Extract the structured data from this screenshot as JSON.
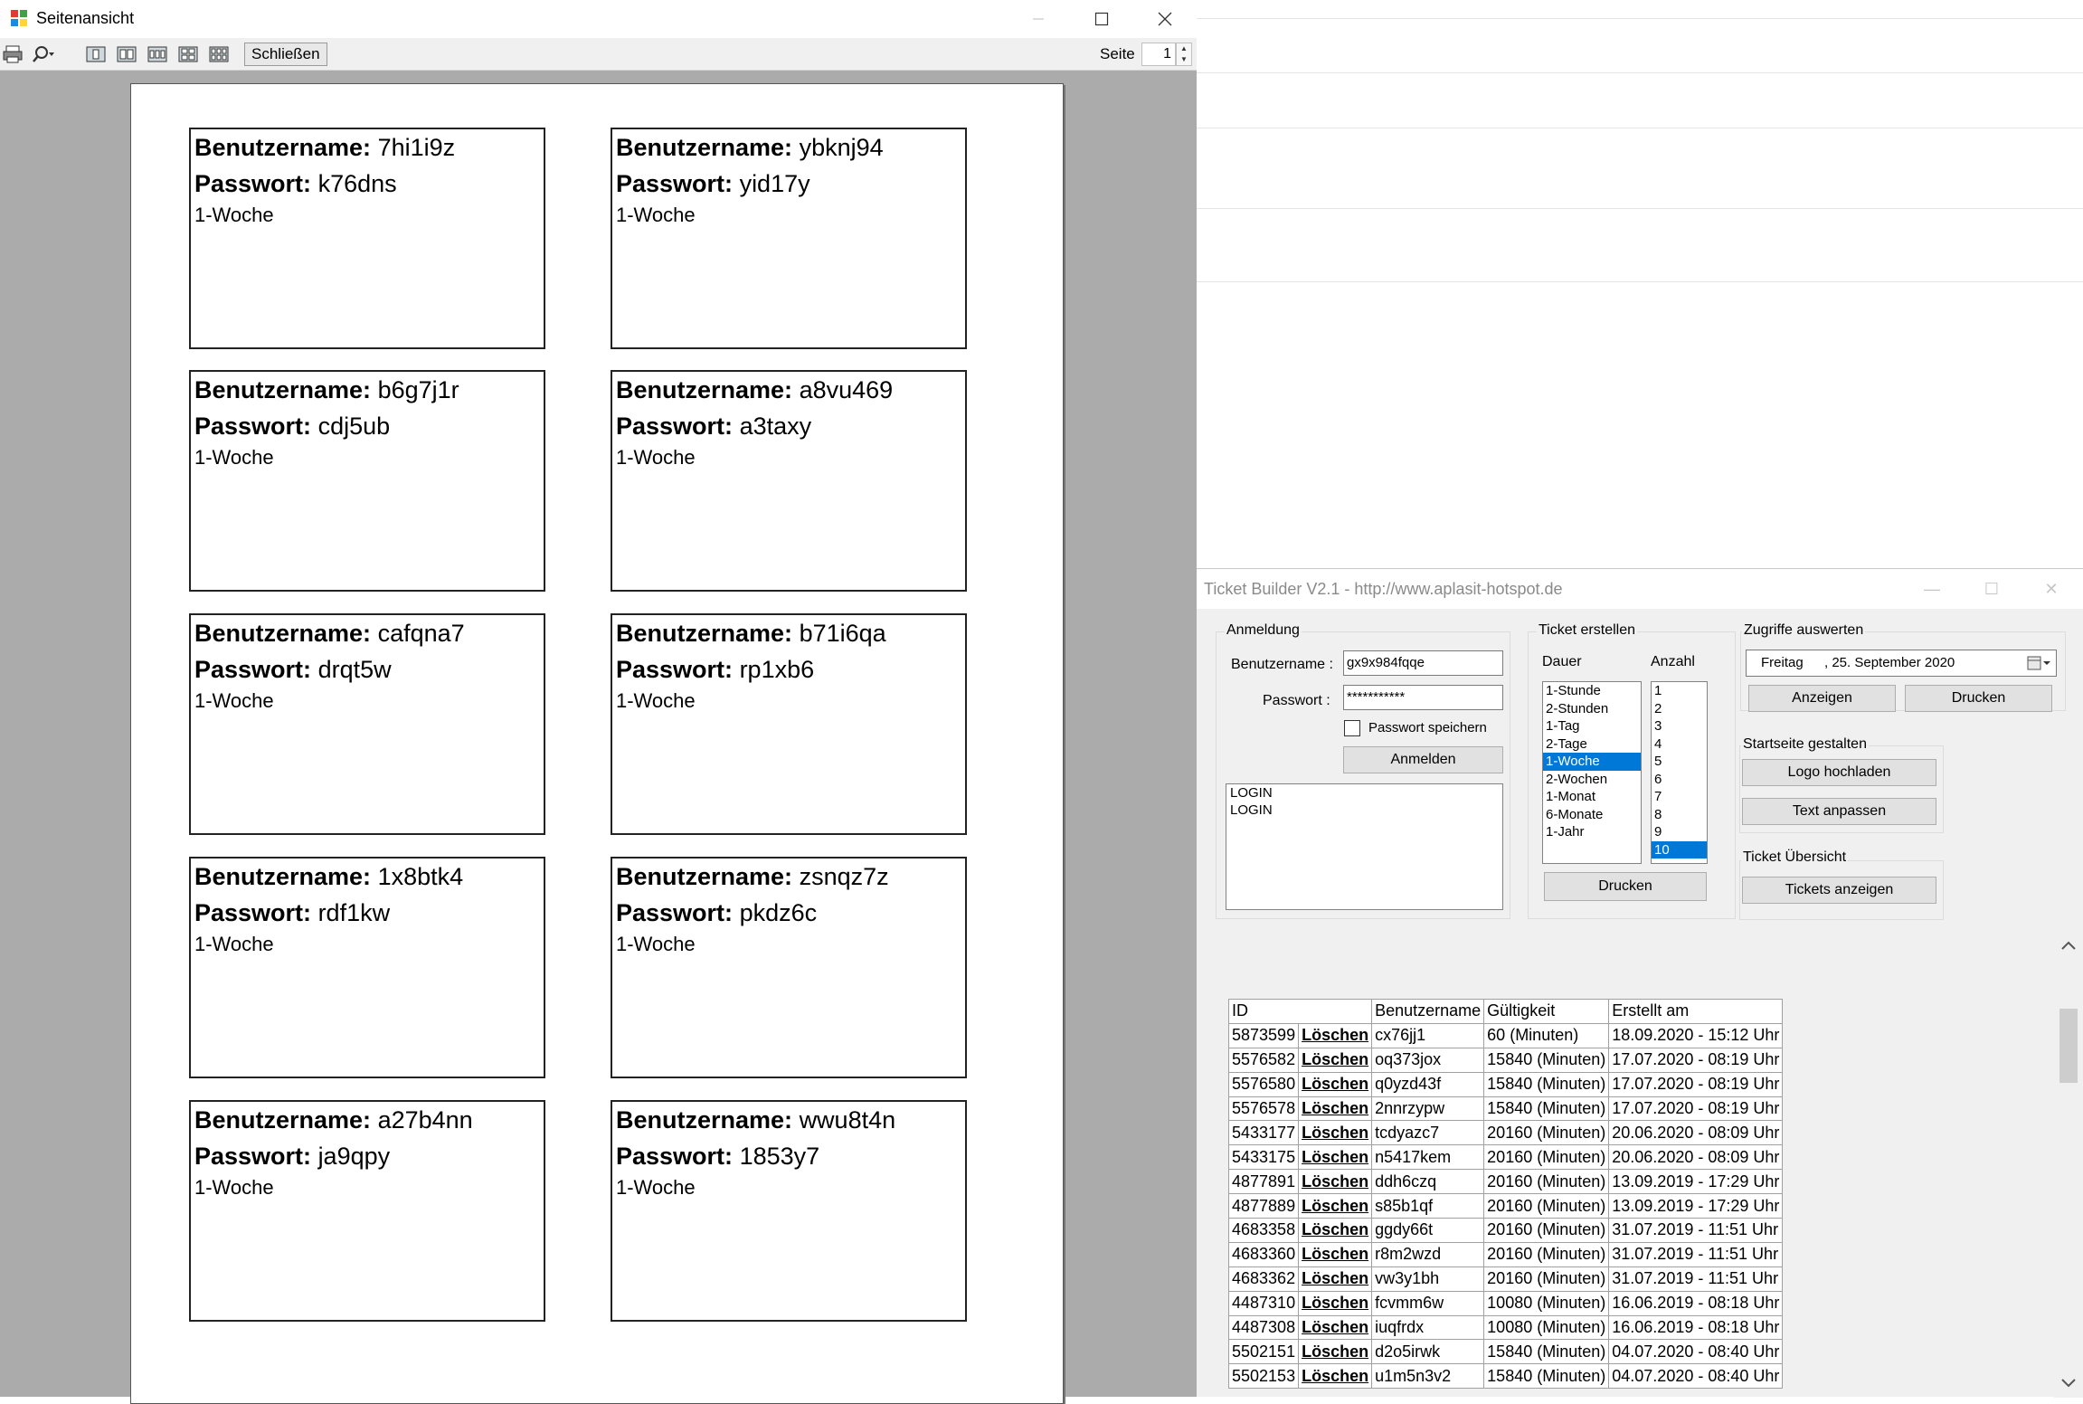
{
  "preview": {
    "title": "Seitenansicht",
    "close_label": "Schließen",
    "page_label": "Seite",
    "page_value": "1",
    "cards": [
      {
        "user_label": "Benutzername:",
        "user": "7hi1i9z",
        "pass_label": "Passwort:",
        "pass": "k76dns",
        "duration": "1-Woche"
      },
      {
        "user_label": "Benutzername:",
        "user": "ybknj94",
        "pass_label": "Passwort:",
        "pass": "yid17y",
        "duration": "1-Woche"
      },
      {
        "user_label": "Benutzername:",
        "user": "b6g7j1r",
        "pass_label": "Passwort:",
        "pass": "cdj5ub",
        "duration": "1-Woche"
      },
      {
        "user_label": "Benutzername:",
        "user": "a8vu469",
        "pass_label": "Passwort:",
        "pass": "a3taxy",
        "duration": "1-Woche"
      },
      {
        "user_label": "Benutzername:",
        "user": "cafqna7",
        "pass_label": "Passwort:",
        "pass": "drqt5w",
        "duration": "1-Woche"
      },
      {
        "user_label": "Benutzername:",
        "user": "b71i6qa",
        "pass_label": "Passwort:",
        "pass": "rp1xb6",
        "duration": "1-Woche"
      },
      {
        "user_label": "Benutzername:",
        "user": "1x8btk4",
        "pass_label": "Passwort:",
        "pass": "rdf1kw",
        "duration": "1-Woche"
      },
      {
        "user_label": "Benutzername:",
        "user": "zsnqz7z",
        "pass_label": "Passwort:",
        "pass": "pkdz6c",
        "duration": "1-Woche"
      },
      {
        "user_label": "Benutzername:",
        "user": "a27b4nn",
        "pass_label": "Passwort:",
        "pass": "ja9qpy",
        "duration": "1-Woche"
      },
      {
        "user_label": "Benutzername:",
        "user": "wwu8t4n",
        "pass_label": "Passwort:",
        "pass": "1853y7",
        "duration": "1-Woche"
      }
    ]
  },
  "ticket_builder": {
    "title": "Ticket Builder V2.1 - http://www.aplasit-hotspot.de",
    "anmeldung": {
      "group": "Anmeldung",
      "user_label": "Benutzername :",
      "user_value": "gx9x984fqqe",
      "pass_label": "Passwort :",
      "pass_value": "***********",
      "remember_label": "Passwort speichern",
      "login_button": "Anmelden",
      "log_lines": [
        "LOGIN",
        "LOGIN"
      ]
    },
    "ticket_erstellen": {
      "group": "Ticket erstellen",
      "dauer_label": "Dauer",
      "anzahl_label": "Anzahl",
      "dauer_items": [
        "1-Stunde",
        "2-Stunden",
        "1-Tag",
        "2-Tage",
        "1-Woche",
        "2-Wochen",
        "1-Monat",
        "6-Monate",
        "1-Jahr"
      ],
      "dauer_selected": "1-Woche",
      "anzahl_items": [
        "1",
        "2",
        "3",
        "4",
        "5",
        "6",
        "7",
        "8",
        "9",
        "10"
      ],
      "anzahl_selected": "10",
      "print_button": "Drucken"
    },
    "zugriffe": {
      "group": "Zugriffe auswerten",
      "date_day": "Freitag",
      "date_value": ", 25. September 2020",
      "show_button": "Anzeigen",
      "print_button": "Drucken"
    },
    "startseite": {
      "group": "Startseite gestalten",
      "logo_button": "Logo hochladen",
      "text_button": "Text anpassen"
    },
    "uebersicht": {
      "group": "Ticket Übersicht",
      "show_button": "Tickets anzeigen"
    },
    "table": {
      "headers": [
        "ID",
        "",
        "Benutzername",
        "Gültigkeit",
        "Erstellt am"
      ],
      "delete_label": "Löschen",
      "rows": [
        [
          "5873599",
          "cx76jj1",
          "60 (Minuten)",
          "18.09.2020 - 15:12 Uhr"
        ],
        [
          "5576582",
          "oq373jox",
          "15840 (Minuten)",
          "17.07.2020 - 08:19 Uhr"
        ],
        [
          "5576580",
          "q0yzd43f",
          "15840 (Minuten)",
          "17.07.2020 - 08:19 Uhr"
        ],
        [
          "5576578",
          "2nnrzypw",
          "15840 (Minuten)",
          "17.07.2020 - 08:19 Uhr"
        ],
        [
          "5433177",
          "tcdyazc7",
          "20160 (Minuten)",
          "20.06.2020 - 08:09 Uhr"
        ],
        [
          "5433175",
          "n5417kem",
          "20160 (Minuten)",
          "20.06.2020 - 08:09 Uhr"
        ],
        [
          "4877891",
          "ddh6czq",
          "20160 (Minuten)",
          "13.09.2019 - 17:29 Uhr"
        ],
        [
          "4877889",
          "s85b1qf",
          "20160 (Minuten)",
          "13.09.2019 - 17:29 Uhr"
        ],
        [
          "4683358",
          "ggdy66t",
          "20160 (Minuten)",
          "31.07.2019 - 11:51 Uhr"
        ],
        [
          "4683360",
          "r8m2wzd",
          "20160 (Minuten)",
          "31.07.2019 - 11:51 Uhr"
        ],
        [
          "4683362",
          "vw3y1bh",
          "20160 (Minuten)",
          "31.07.2019 - 11:51 Uhr"
        ],
        [
          "4487310",
          "fcvmm6w",
          "10080 (Minuten)",
          "16.06.2019 - 08:18 Uhr"
        ],
        [
          "4487308",
          "iuqfrdx",
          "10080 (Minuten)",
          "16.06.2019 - 08:18 Uhr"
        ],
        [
          "5502151",
          "d2o5irwk",
          "15840 (Minuten)",
          "04.07.2020 - 08:40 Uhr"
        ],
        [
          "5502153",
          "u1m5n3v2",
          "15840 (Minuten)",
          "04.07.2020 - 08:40 Uhr"
        ]
      ]
    }
  },
  "colors": {
    "selection": "#0078d7",
    "preview_background": "#ababab"
  }
}
